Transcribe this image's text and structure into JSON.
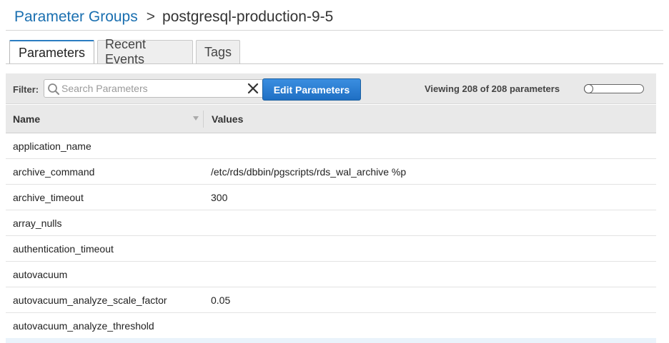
{
  "breadcrumb": {
    "parent": "Parameter Groups",
    "separator": ">",
    "current": "postgresql-production-9-5"
  },
  "tabs": [
    {
      "label": "Parameters",
      "active": true
    },
    {
      "label": "Recent Events",
      "active": false
    },
    {
      "label": "Tags",
      "active": false
    }
  ],
  "toolbar": {
    "filter_label": "Filter:",
    "search_placeholder": "Search Parameters",
    "search_value": "",
    "edit_button": "Edit Parameters",
    "viewing_text": "Viewing 208 of 208 parameters"
  },
  "table": {
    "columns": [
      "Name",
      "Values"
    ],
    "rows": [
      {
        "name": "application_name",
        "value": ""
      },
      {
        "name": "archive_command",
        "value": "/etc/rds/dbbin/pgscripts/rds_wal_archive %p"
      },
      {
        "name": "archive_timeout",
        "value": "300"
      },
      {
        "name": "array_nulls",
        "value": ""
      },
      {
        "name": "authentication_timeout",
        "value": ""
      },
      {
        "name": "autovacuum",
        "value": ""
      },
      {
        "name": "autovacuum_analyze_scale_factor",
        "value": "0.05"
      },
      {
        "name": "autovacuum_analyze_threshold",
        "value": ""
      }
    ]
  },
  "colors": {
    "link": "#1a6fb0",
    "primary_button": "#1f6fc4",
    "header_bg": "#e9e9e9"
  },
  "icons": [
    "search-icon",
    "clear-icon",
    "sort-descending-icon"
  ]
}
